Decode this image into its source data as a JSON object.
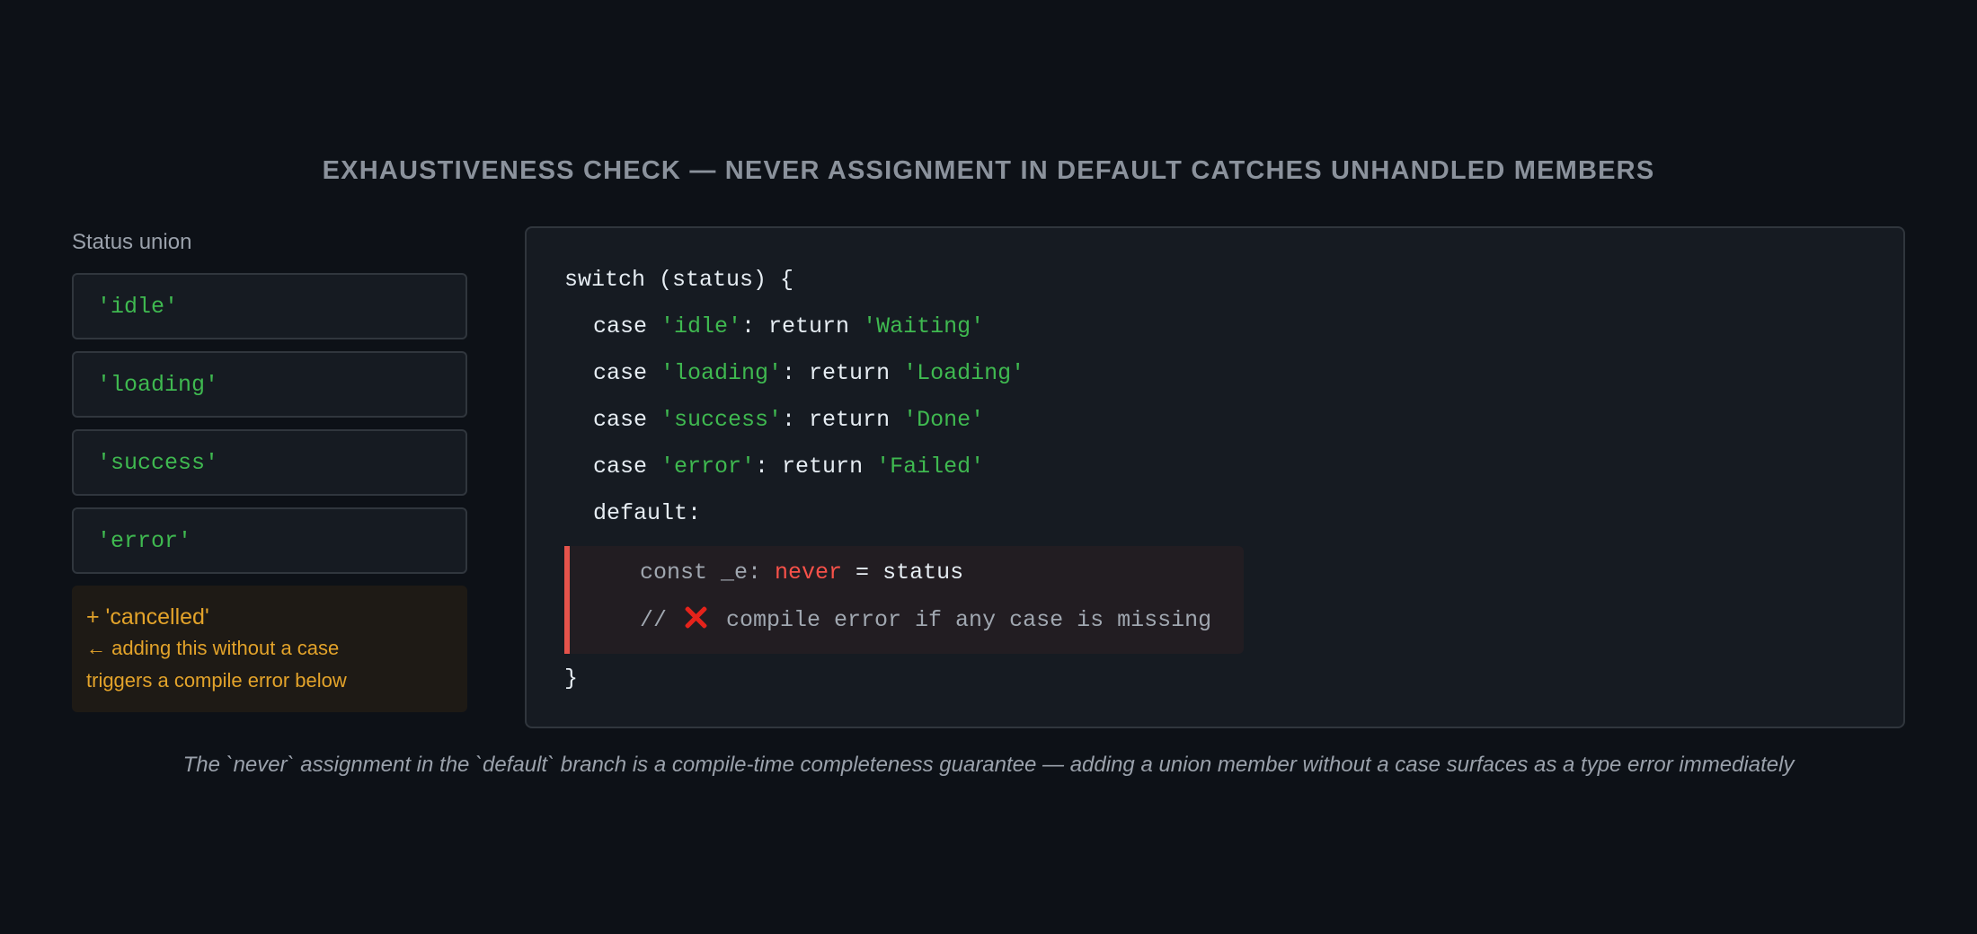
{
  "title": "EXHAUSTIVENESS CHECK — NEVER ASSIGNMENT IN DEFAULT CATCHES UNHANDLED MEMBERS",
  "union": {
    "label": "Status union",
    "members": [
      "'idle'",
      "'loading'",
      "'success'",
      "'error'"
    ]
  },
  "added_member": {
    "title": "+ 'cancelled'",
    "line1": "← adding this without a case",
    "line2": "triggers a compile error below"
  },
  "code": {
    "switch_open": "switch (status) {",
    "cases": [
      {
        "kw": "case ",
        "value": "'idle'",
        "mid": ": return ",
        "result": "'Waiting'"
      },
      {
        "kw": "case ",
        "value": "'loading'",
        "mid": ": return ",
        "result": "'Loading'"
      },
      {
        "kw": "case ",
        "value": "'success'",
        "mid": ": return ",
        "result": "'Done'"
      },
      {
        "kw": "case ",
        "value": "'error'",
        "mid": ": return ",
        "result": "'Failed'"
      }
    ],
    "default_label": "default:",
    "never_line": {
      "prefix": "const _e: ",
      "type": "never",
      "eq": " = ",
      "target": "status"
    },
    "comment": {
      "prefix": "// ",
      "icon": "cross-mark-icon",
      "text": " compile error if any case is missing"
    },
    "close": "}"
  },
  "caption": "The `never` assignment in the `default` branch is a compile-time completeness guarantee — adding a union member without a case surfaces as a type error immediately",
  "colors": {
    "background": "#0d1117",
    "string": "#3fb950",
    "never": "#f85149",
    "warning": "#e3a32a",
    "error_bar": "#e5534b"
  }
}
